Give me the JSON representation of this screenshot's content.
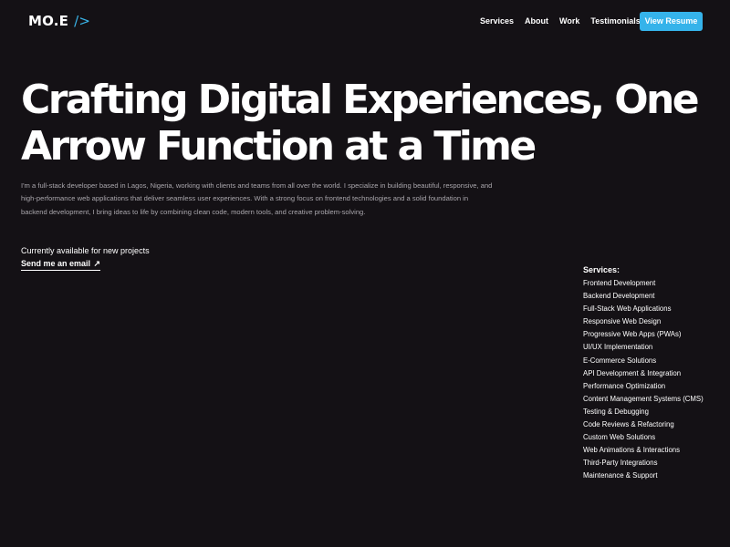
{
  "header": {
    "logo_text": "MO.E",
    "logo_accent": "/>",
    "nav": [
      "Services",
      "About",
      "Work",
      "Testimonials"
    ],
    "resume_button": "View Resume"
  },
  "hero": {
    "title_line1": "Crafting Digital Experiences, One",
    "title_line2": "Arrow Function at a Time",
    "intro": "I'm a  full-stack developer based in Lagos, Nigeria, working with clients and teams from all over the world. I specialize in building beautiful, responsive, and high-performance web applications that deliver seamless user experiences. With a strong focus on  frontend technologies and a solid foundation in  backend development, I bring ideas to life by combining  clean code, modern tools, and creative problem-solving.",
    "availability": "Currently available for new projects",
    "email_link": "Send me an email",
    "email_arrow": "↗"
  },
  "services": {
    "heading": "Services:",
    "items": [
      "Frontend Development",
      "Backend Development",
      "Full-Stack Web Applications",
      "Responsive Web Design",
      "Progressive Web Apps (PWAs)",
      "UI/UX Implementation",
      "E-Commerce Solutions",
      "API Development & Integration",
      "Performance Optimization",
      "Content Management Systems (CMS)",
      "Testing & Debugging",
      "Code Reviews & Refactoring",
      "Custom Web Solutions",
      "Web Animations & Interactions",
      "Third-Party Integrations",
      "Maintenance & Support"
    ]
  },
  "colors": {
    "background": "#141115",
    "accent": "#35b3ea",
    "text": "#ffffff",
    "muted_text": "#a9a6ac"
  }
}
